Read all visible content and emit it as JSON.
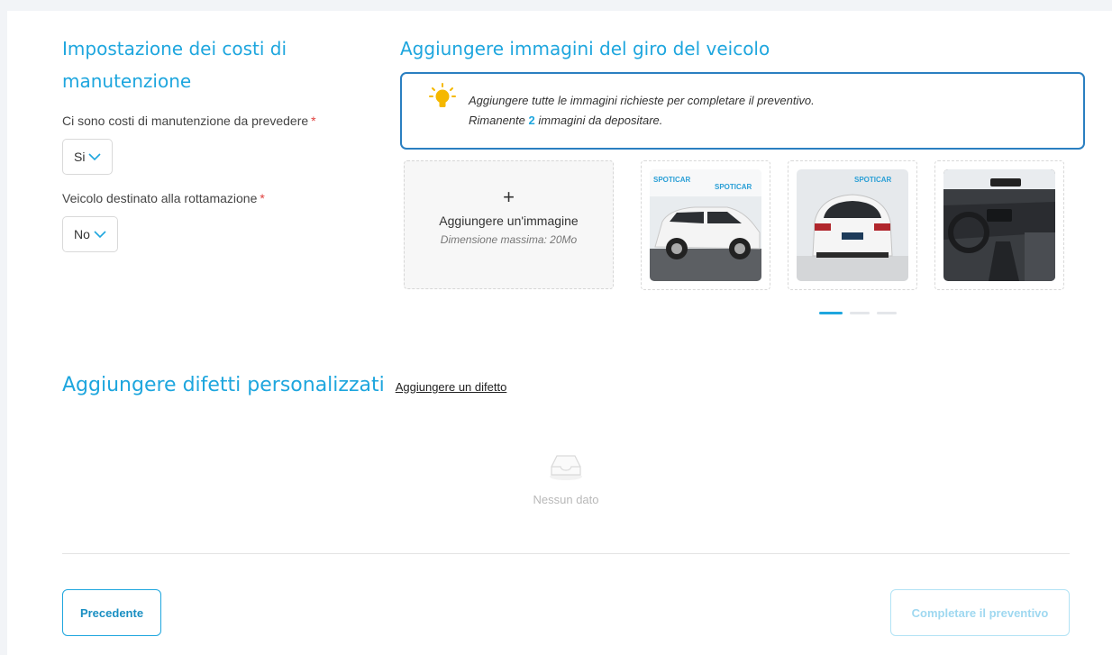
{
  "maintenance": {
    "title": "Impostazione dei costi di manutenzione",
    "costs_label": "Ci sono costi di manutenzione da prevedere",
    "costs_required": "*",
    "costs_value": "Si",
    "scrap_label": "Veicolo destinato alla rottamazione",
    "scrap_required": "*",
    "scrap_value": "No"
  },
  "images": {
    "title": "Aggiungere immagini del giro del veicolo",
    "info_line1": "Aggiungere tutte le immagini richieste per completare il preventivo.",
    "info_line2_prefix": "Rimanente",
    "remaining_count": "2",
    "info_line2_suffix": "immagini da depositare.",
    "add_plus": "+",
    "add_label": "Aggiungere un'immagine",
    "add_hint": "Dimensione massima: 20Mo",
    "thumbnails": [
      {
        "name": "car-side-photo",
        "logo": "SPOTICAR"
      },
      {
        "name": "car-rear-photo",
        "logo": "SPOTICAR"
      },
      {
        "name": "car-interior-photo",
        "logo": ""
      }
    ],
    "carousel": {
      "pages": 3,
      "active": 0
    }
  },
  "defects": {
    "title": "Aggiungere difetti personalizzati",
    "add_link": "Aggiungere un difetto",
    "empty_text": "Nessun dato"
  },
  "footer": {
    "prev_label": "Precedente",
    "next_label": "Completare il preventivo"
  },
  "colors": {
    "accent": "#1ea6de",
    "info_border": "#2a7fc1",
    "required": "#e0403d",
    "disabled_text": "#9fd8f0"
  },
  "icons": {
    "bulb": "lightbulb-icon",
    "chevron": "chevron-down-icon",
    "empty": "empty-inbox-icon"
  }
}
